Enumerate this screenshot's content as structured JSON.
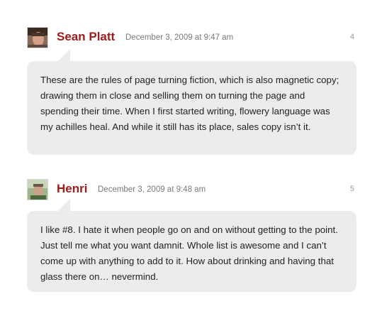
{
  "comments": [
    {
      "author": "Sean Platt",
      "date": "December 3, 2009 at 9:47 am",
      "number": "4",
      "text": "These are the rules of page turning fiction, which is also magnetic copy; drawing them in close and selling them on turning the page and spending their time. When I first started writing, flowery language was my achilles heal. And while it still has its place, sales copy isn’t it."
    },
    {
      "author": "Henri",
      "date": "December 3, 2009 at 9:48 am",
      "number": "5",
      "text": "I like #8. I hate it when people go on and on without getting to the point. Just tell me what you want damnit. Whole list is awesome and I can’t come up with anything to add to it. How about drinking and having that glass there on… nevermind."
    }
  ],
  "colors": {
    "author": "#a11c1c",
    "bubble": "#ececec",
    "meta": "#7a7a7a"
  }
}
